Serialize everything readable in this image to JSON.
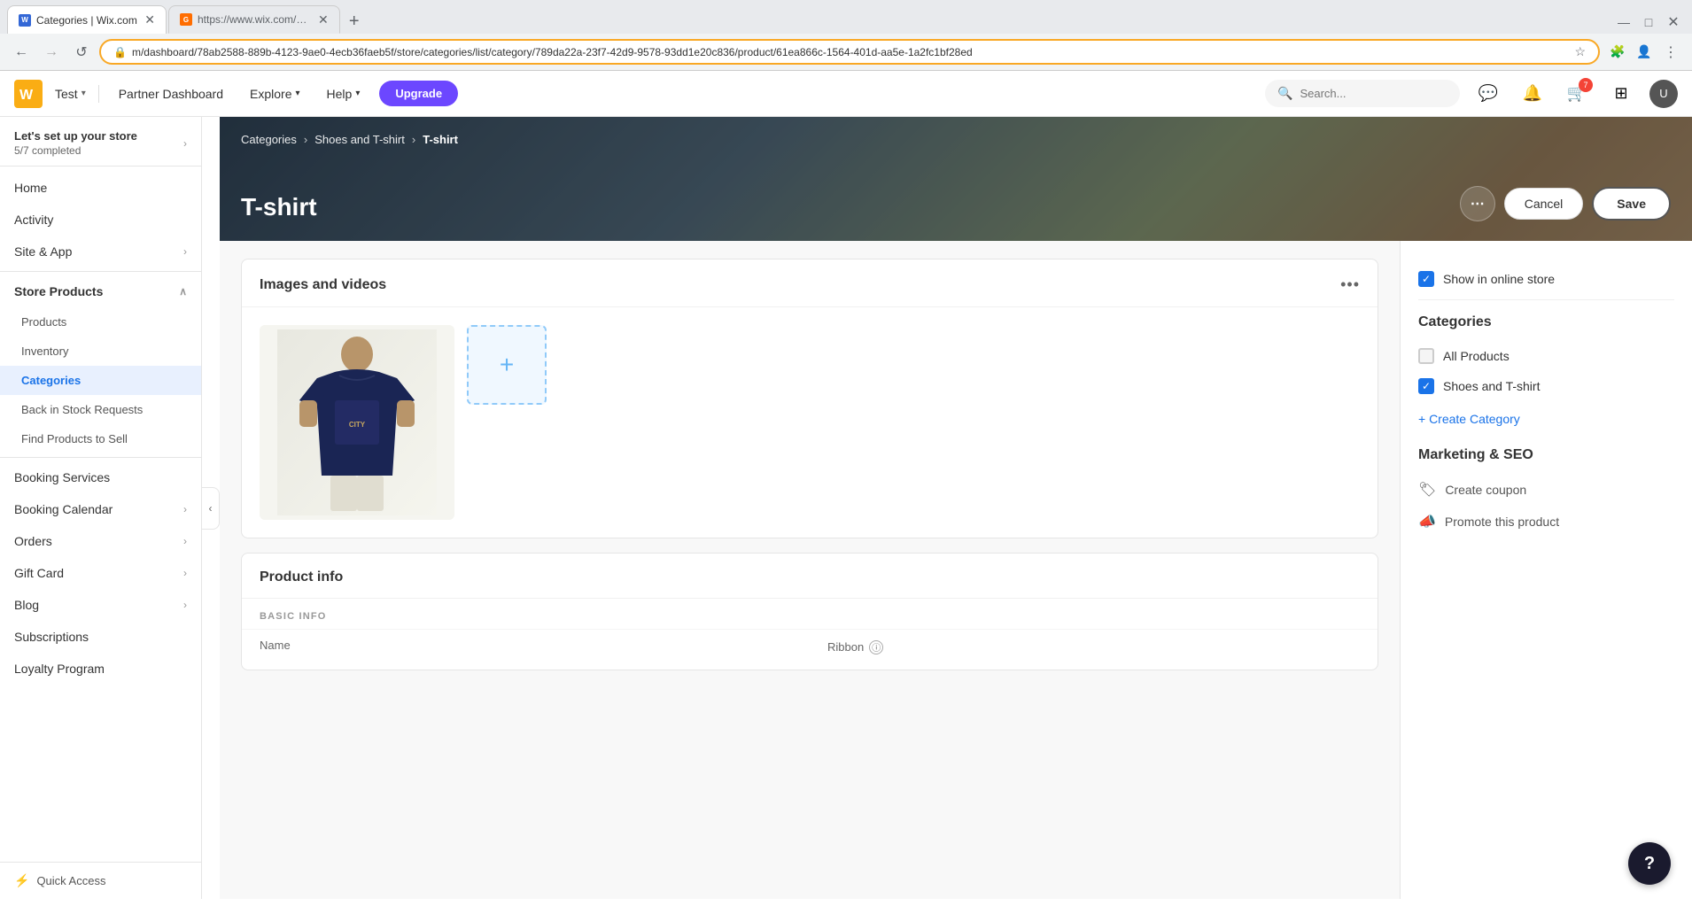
{
  "browser": {
    "tabs": [
      {
        "id": "tab1",
        "favicon_color": "blue",
        "favicon_text": "wx",
        "label": "Categories | Wix.com",
        "active": true
      },
      {
        "id": "tab2",
        "favicon_color": "orange",
        "favicon_text": "G",
        "label": "https://www.wix.com/oauth/acc...",
        "active": false
      }
    ],
    "address": "m/dashboard/78ab2588-889b-4123-9ae0-4ecb36faeb5f/store/categories/list/category/789da22a-23f7-42d9-9578-93dd1e20c836/product/61ea866c-1564-401d-aa5e-1a2fc1bf28ed",
    "address_highlight": "product/61ea866c-1564-401d-aa5e-1a2fc1bf28ed"
  },
  "topbar": {
    "logo_text": "W",
    "site_name": "Test",
    "nav_items": [
      {
        "label": "Partner Dashboard"
      },
      {
        "label": "Explore"
      },
      {
        "label": "Help"
      }
    ],
    "upgrade_label": "Upgrade",
    "search_placeholder": "Search...",
    "notification_badge": "7"
  },
  "sidebar": {
    "setup_title": "Let's set up your store",
    "setup_progress": "5/7 completed",
    "nav_items": [
      {
        "label": "Home",
        "level": "top",
        "active": false,
        "has_children": false
      },
      {
        "label": "Activity",
        "level": "top",
        "active": false,
        "has_children": false
      },
      {
        "label": "Site & App",
        "level": "top",
        "active": false,
        "has_children": true
      },
      {
        "label": "Store Products",
        "level": "parent",
        "active": false,
        "has_children": true,
        "expanded": true
      },
      {
        "label": "Products",
        "level": "sub",
        "active": false
      },
      {
        "label": "Inventory",
        "level": "sub",
        "active": false
      },
      {
        "label": "Categories",
        "level": "sub",
        "active": true
      },
      {
        "label": "Back in Stock Requests",
        "level": "sub",
        "active": false
      },
      {
        "label": "Find Products to Sell",
        "level": "sub",
        "active": false
      },
      {
        "label": "Booking Services",
        "level": "top",
        "active": false,
        "has_children": false
      },
      {
        "label": "Booking Calendar",
        "level": "top",
        "active": false,
        "has_children": true
      },
      {
        "label": "Orders",
        "level": "top",
        "active": false,
        "has_children": true
      },
      {
        "label": "Gift Card",
        "level": "top",
        "active": false,
        "has_children": true
      },
      {
        "label": "Blog",
        "level": "top",
        "active": false,
        "has_children": true
      },
      {
        "label": "Subscriptions",
        "level": "top",
        "active": false,
        "has_children": false
      },
      {
        "label": "Loyalty Program",
        "level": "top",
        "active": false,
        "has_children": false
      }
    ],
    "quick_access_label": "Quick Access"
  },
  "page": {
    "breadcrumbs": [
      "Categories",
      "Shoes and T-shirt",
      "T-shirt"
    ],
    "title": "T-shirt",
    "actions": {
      "more_label": "⋯",
      "cancel_label": "Cancel",
      "save_label": "Save"
    }
  },
  "images_section": {
    "title": "Images and videos",
    "menu_icon": "•••",
    "add_image_icon": "+"
  },
  "product_info_section": {
    "title": "Product info",
    "basic_info_label": "BASIC INFO",
    "name_label": "Name",
    "ribbon_label": "Ribbon"
  },
  "right_panel": {
    "show_in_store_label": "Show in online store",
    "show_in_store_checked": true,
    "categories_title": "Categories",
    "categories": [
      {
        "label": "All Products",
        "checked": false
      },
      {
        "label": "Shoes and T-shirt",
        "checked": true
      }
    ],
    "create_category_label": "+ Create Category",
    "marketing_title": "Marketing & SEO",
    "marketing_items": [
      {
        "label": "Create coupon",
        "icon": "🏷"
      },
      {
        "label": "Promote this product",
        "icon": "📣"
      }
    ]
  },
  "help": {
    "label": "?"
  }
}
